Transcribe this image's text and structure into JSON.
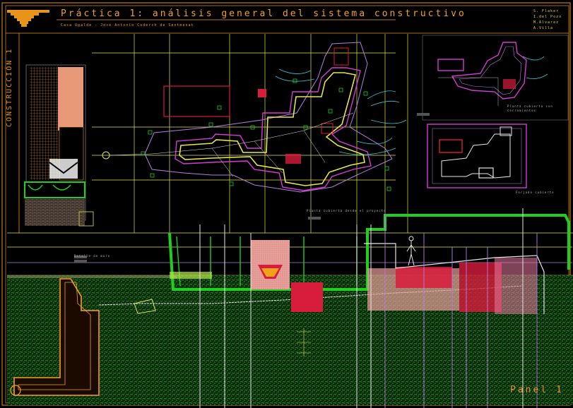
{
  "drawing": {
    "title": "Práctica 1: análisis general del sistema constructivo",
    "subtitle": "Casa Ugalde - José Antonio Coderch de Sentmenat",
    "side_label": "CONSTRUCCIÓN 1",
    "authors": [
      "S. Flaker",
      "I.del Pozo",
      "M.Alvarez",
      "A.Villa"
    ],
    "panel_label": "Panel 1"
  },
  "captions": {
    "site_plan": "Planta cubierta desde el proyecto",
    "plan_top_right": "Planta cubierta con cerramientos",
    "plan_mid_right": "Forjado cubierto",
    "detail_left": "Detalle de muro"
  },
  "colors": {
    "background": "#000000",
    "frame": "#e8941a",
    "title": "#f2a11c",
    "guide_lines": "#e6e64a",
    "wall_main": "#e6e64a",
    "wall_outline": "#d23cd2",
    "section_green": "#1ecf1e",
    "terrain": "#2a7a2a",
    "cyan_contours": "#3ac6d6",
    "red_blocks": "#d81c3c",
    "pink_blocks": "#e87aa0",
    "lilac_lines": "#b57ce6"
  },
  "icons": [
    "drawing-frame",
    "site-plan",
    "floor-plan",
    "section-drawing",
    "human-figure-icon"
  ]
}
